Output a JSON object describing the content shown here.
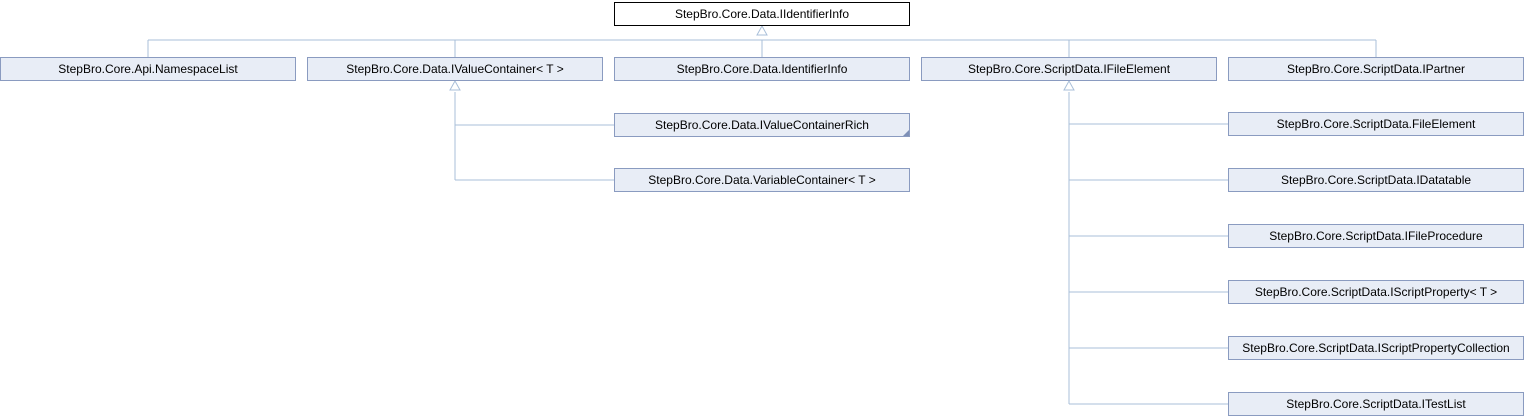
{
  "root": {
    "label": "StepBro.Core.Data.IIdentifierInfo"
  },
  "level1": [
    {
      "label": "StepBro.Core.Api.NamespaceList"
    },
    {
      "label": "StepBro.Core.Data.IValueContainer< T >"
    },
    {
      "label": "StepBro.Core.Data.IdentifierInfo"
    },
    {
      "label": "StepBro.Core.ScriptData.IFileElement"
    },
    {
      "label": "StepBro.Core.ScriptData.IPartner"
    }
  ],
  "value_container_children": [
    {
      "label": "StepBro.Core.Data.IValueContainerRich"
    },
    {
      "label": "StepBro.Core.Data.VariableContainer< T >"
    }
  ],
  "file_element_children": [
    {
      "label": "StepBro.Core.ScriptData.FileElement"
    },
    {
      "label": "StepBro.Core.ScriptData.IDatatable"
    },
    {
      "label": "StepBro.Core.ScriptData.IFileProcedure"
    },
    {
      "label": "StepBro.Core.ScriptData.IScriptProperty< T >"
    },
    {
      "label": "StepBro.Core.ScriptData.IScriptPropertyCollection"
    },
    {
      "label": "StepBro.Core.ScriptData.ITestList"
    }
  ],
  "colors": {
    "edge": "#a9bfd9",
    "node_fill": "#e8edf6",
    "node_border": "#8a9bc0",
    "root_border": "#000000"
  }
}
